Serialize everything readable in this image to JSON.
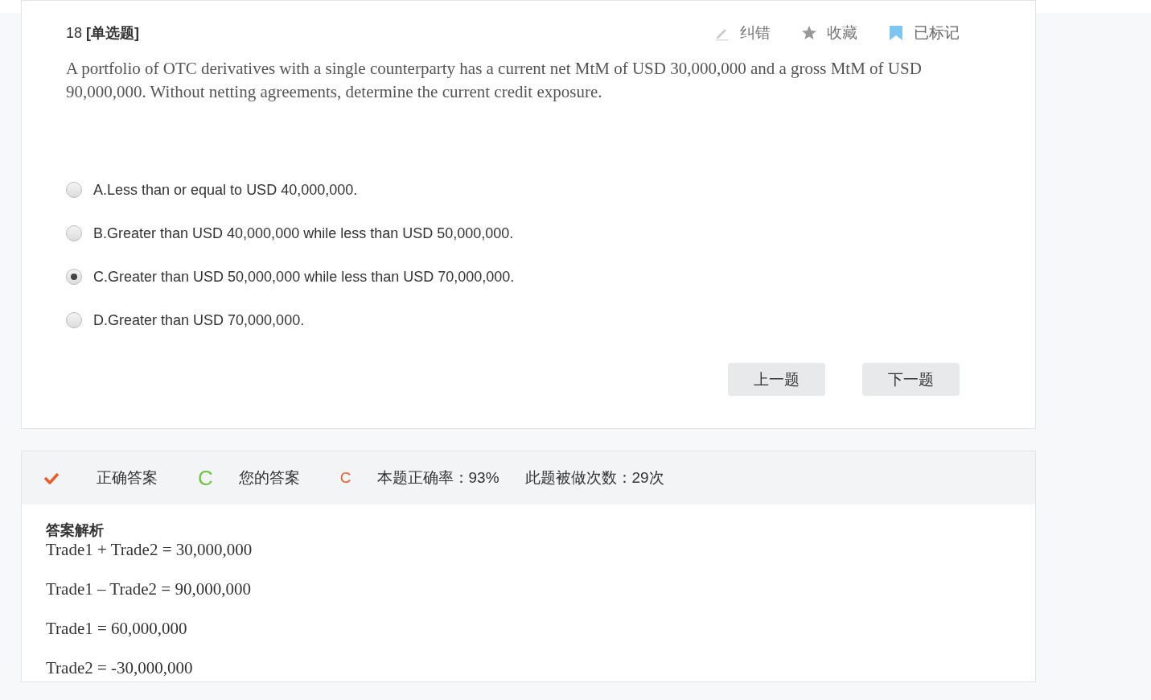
{
  "question": {
    "number": "18",
    "type": "[单选题]",
    "text": "A portfolio of OTC derivatives with a single counterparty has a current net MtM of USD 30,000,000 and a gross MtM of USD 90,000,000. Without netting agreements, determine the current credit exposure."
  },
  "tools": [
    {
      "kind": "pencil",
      "label": "纠错",
      "active": false
    },
    {
      "kind": "star",
      "label": "收藏",
      "active": false
    },
    {
      "kind": "bookmark",
      "label": "已标记",
      "active": true
    }
  ],
  "options": [
    {
      "label": "A.Less than or equal to USD 40,000,000.",
      "selected": false
    },
    {
      "label": "B.Greater than USD 40,000,000 while less than USD 50,000,000.",
      "selected": false
    },
    {
      "label": "C.Greater than USD 50,000,000 while less than USD 70,000,000.",
      "selected": true
    },
    {
      "label": "D.Greater than USD 70,000,000.",
      "selected": false
    }
  ],
  "nav_buttons": [
    "上一题",
    "下一题"
  ],
  "result": {
    "correct": true,
    "correct_label": "正确答案",
    "correct_answer": "C",
    "your_label": "您的答案",
    "your_answer": "C",
    "accuracy": "本题正确率：93%",
    "attempts": "此题被做次数：29次"
  },
  "analysis": {
    "title": "答案解析",
    "lines": [
      "Trade1 + Trade2 = 30,000,000",
      "Trade1 – Trade2 = 90,000,000",
      "Trade1 = 60,000,000",
      "Trade2 = -30,000,000"
    ]
  }
}
